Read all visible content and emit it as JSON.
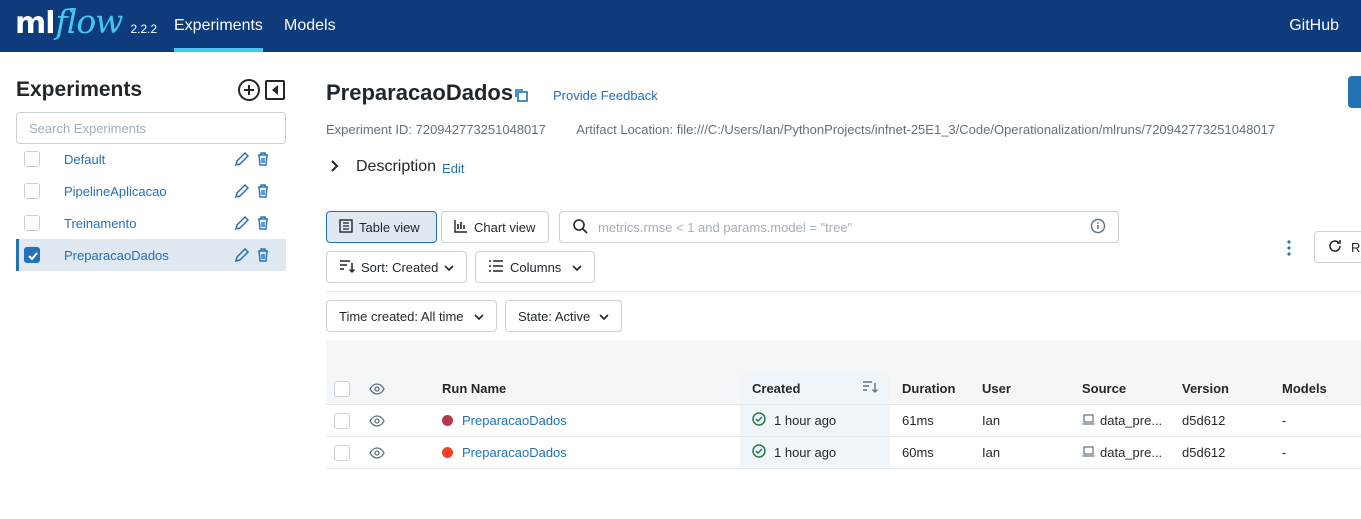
{
  "header": {
    "logo_ml": "ml",
    "logo_flow": "flow",
    "version": "2.2.2",
    "nav": [
      "Experiments",
      "Models"
    ],
    "github": "GitHub"
  },
  "sidebar": {
    "title": "Experiments",
    "search_placeholder": "Search Experiments",
    "items": [
      {
        "label": "Default",
        "checked": false
      },
      {
        "label": "PipelineAplicacao",
        "checked": false
      },
      {
        "label": "Treinamento",
        "checked": false
      },
      {
        "label": "PreparacaoDados",
        "checked": true
      }
    ]
  },
  "main": {
    "title": "PreparacaoDados",
    "feedback": "Provide Feedback",
    "experiment_id_label": "Experiment ID:",
    "experiment_id": "720942773251048017",
    "artifact_label": "Artifact Location:",
    "artifact_location": "file:///C:/Users/Ian/PythonProjects/infnet-25E1_3/Code/Operationalization/mlruns/720942773251048017",
    "description": "Description",
    "edit": "Edit"
  },
  "toolbar": {
    "table_view": "Table view",
    "chart_view": "Chart view",
    "search_placeholder": "metrics.rmse < 1 and params.model = \"tree\"",
    "sort": "Sort: Created",
    "columns": "Columns",
    "time_created": "Time created: All time",
    "state": "State: Active",
    "refresh": "Re"
  },
  "table": {
    "headers": {
      "run_name": "Run Name",
      "created": "Created",
      "duration": "Duration",
      "user": "User",
      "source": "Source",
      "version": "Version",
      "models": "Models"
    },
    "rows": [
      {
        "run_name": "PreparacaoDados",
        "color": "#b5394d",
        "created": "1 hour ago",
        "duration": "61ms",
        "user": "Ian",
        "source": "data_pre...",
        "version": "d5d612",
        "models": "-"
      },
      {
        "run_name": "PreparacaoDados",
        "color": "#f2402b",
        "created": "1 hour ago",
        "duration": "60ms",
        "user": "Ian",
        "source": "data_pre...",
        "version": "d5d612",
        "models": "-"
      }
    ]
  },
  "colors": {
    "header_bg": "#0d3b7c",
    "accent": "#43c9ed",
    "link": "#2272b4",
    "success": "#277c43"
  }
}
